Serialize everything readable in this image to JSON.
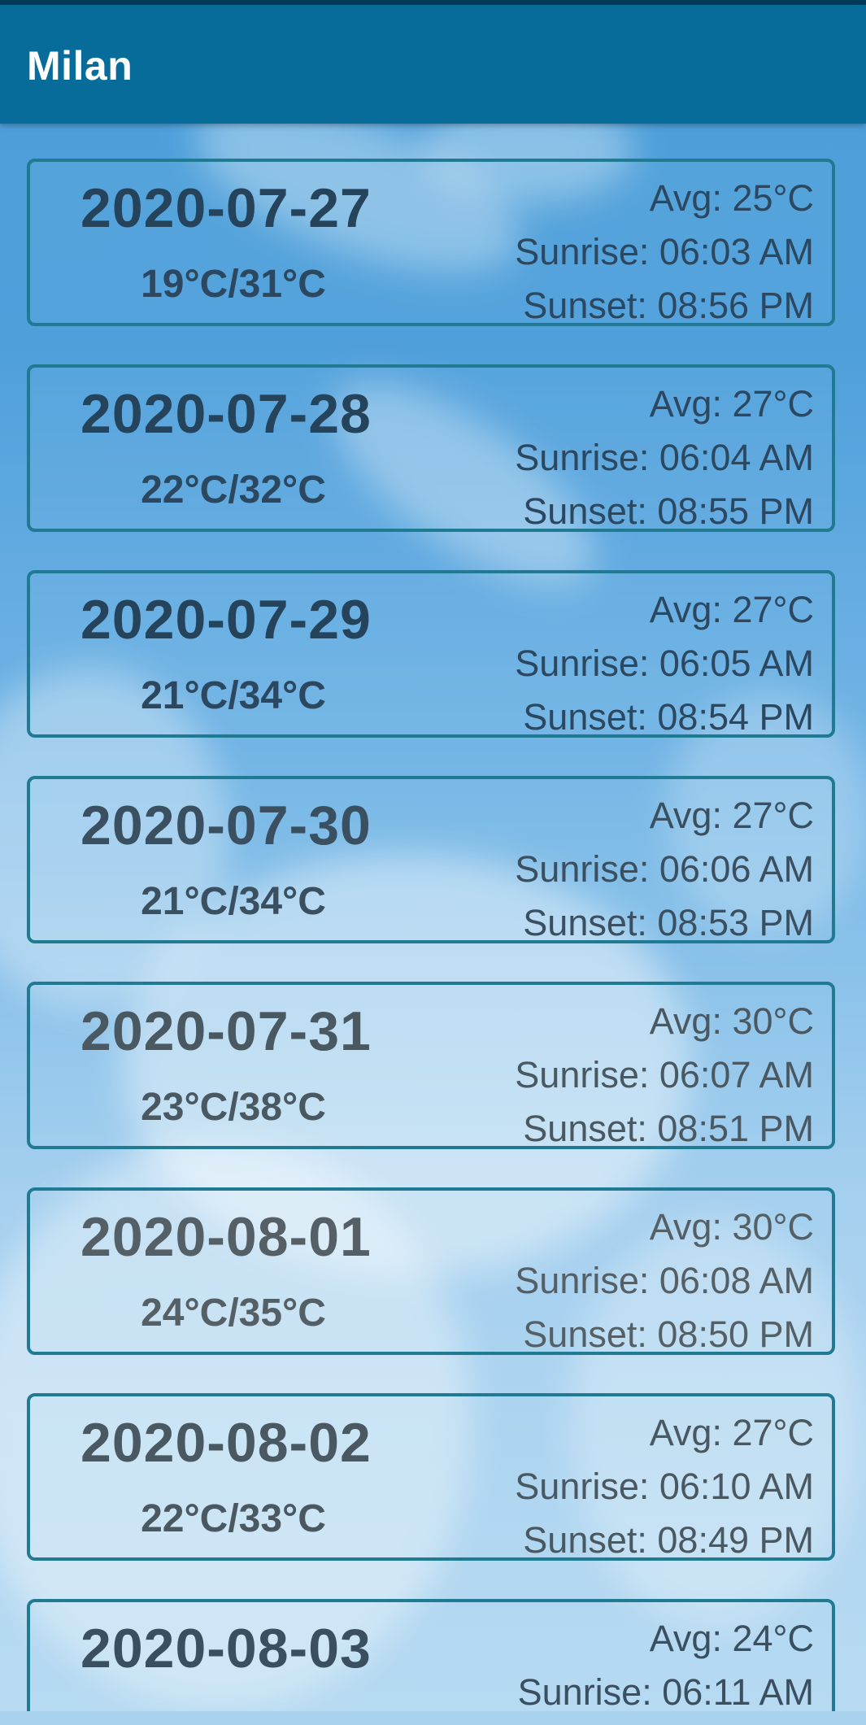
{
  "app_bar": {
    "title": "Milan"
  },
  "forecast": [
    {
      "date": "2020-07-27",
      "range": "19°C/31°C",
      "avg": "Avg: 25°C",
      "sunrise": "Sunrise: 06:03 AM",
      "sunset": "Sunset: 08:56 PM"
    },
    {
      "date": "2020-07-28",
      "range": "22°C/32°C",
      "avg": "Avg: 27°C",
      "sunrise": "Sunrise: 06:04 AM",
      "sunset": "Sunset: 08:55 PM"
    },
    {
      "date": "2020-07-29",
      "range": "21°C/34°C",
      "avg": "Avg: 27°C",
      "sunrise": "Sunrise: 06:05 AM",
      "sunset": "Sunset: 08:54 PM"
    },
    {
      "date": "2020-07-30",
      "range": "21°C/34°C",
      "avg": "Avg: 27°C",
      "sunrise": "Sunrise: 06:06 AM",
      "sunset": "Sunset: 08:53 PM"
    },
    {
      "date": "2020-07-31",
      "range": "23°C/38°C",
      "avg": "Avg: 30°C",
      "sunrise": "Sunrise: 06:07 AM",
      "sunset": "Sunset: 08:51 PM"
    },
    {
      "date": "2020-08-01",
      "range": "24°C/35°C",
      "avg": "Avg: 30°C",
      "sunrise": "Sunrise: 06:08 AM",
      "sunset": "Sunset: 08:50 PM"
    },
    {
      "date": "2020-08-02",
      "range": "22°C/33°C",
      "avg": "Avg: 27°C",
      "sunrise": "Sunrise: 06:10 AM",
      "sunset": "Sunset: 08:49 PM"
    },
    {
      "date": "2020-08-03",
      "range": "",
      "avg": "Avg: 24°C",
      "sunrise": "Sunrise: 06:11 AM",
      "sunset": ""
    }
  ],
  "colors": {
    "app_bar": "#086c9b",
    "status_strip": "#063a56",
    "card_border": "#1f7a92",
    "text": "#25435a"
  }
}
